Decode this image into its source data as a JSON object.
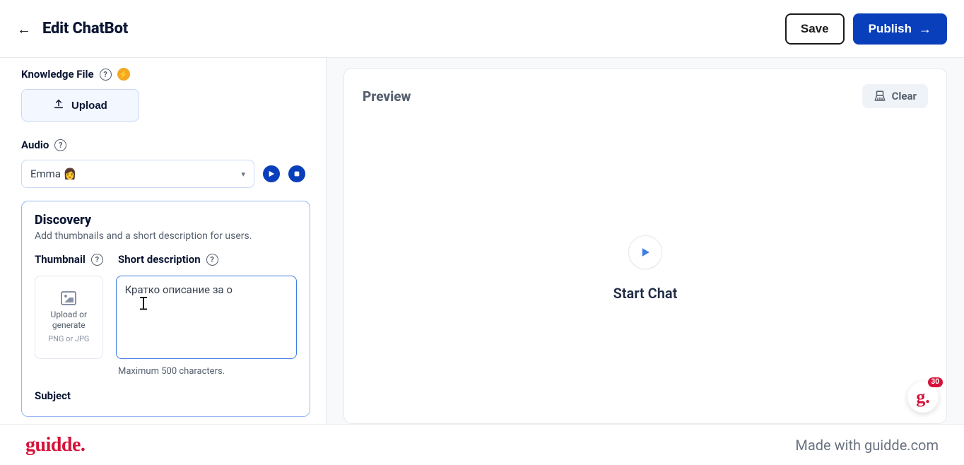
{
  "header": {
    "title": "Edit ChatBot",
    "save_label": "Save",
    "publish_label": "Publish"
  },
  "knowledge": {
    "label": "Knowledge File",
    "upload_label": "Upload"
  },
  "audio": {
    "label": "Audio",
    "selected": "Emma 👩"
  },
  "discovery": {
    "title": "Discovery",
    "subtitle": "Add thumbnails and a short description for users.",
    "thumbnail_label": "Thumbnail",
    "shortdesc_label": "Short description",
    "thumb_main": "Upload or generate",
    "thumb_sub": "PNG or JPG",
    "desc_value": "Кратко описание за о",
    "desc_helper": "Maximum 500 characters."
  },
  "subject": {
    "label": "Subject"
  },
  "preview": {
    "title": "Preview",
    "clear_label": "Clear",
    "start_label": "Start Chat"
  },
  "badge": {
    "count": "30"
  },
  "footer": {
    "brand": "guidde.",
    "credit": "Made with guidde.com"
  }
}
